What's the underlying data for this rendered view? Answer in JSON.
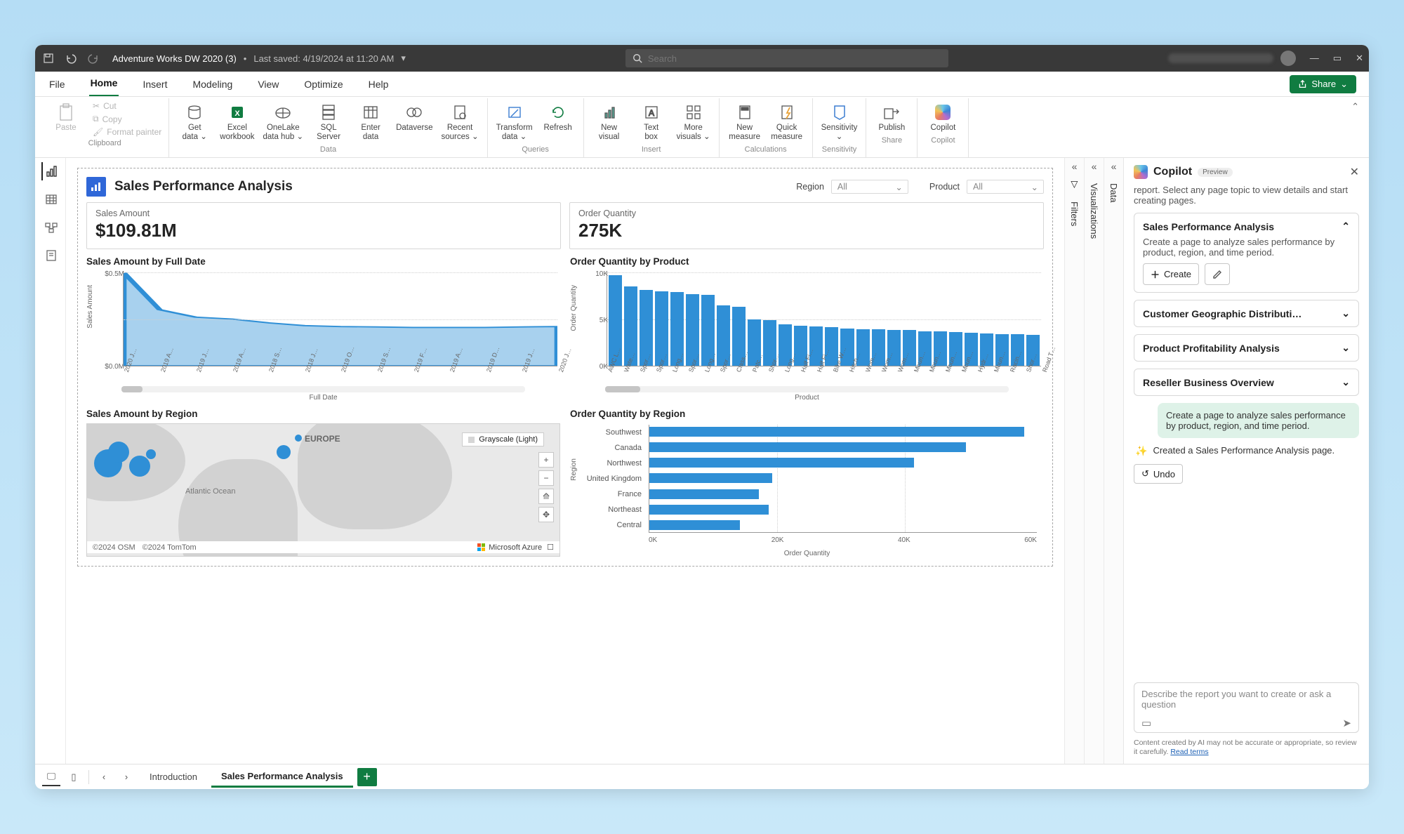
{
  "titlebar": {
    "file_name": "Adventure Works DW 2020 (3)",
    "saved": "Last saved: 4/19/2024 at 11:20 AM",
    "search_placeholder": "Search"
  },
  "menus": {
    "file": "File",
    "home": "Home",
    "insert": "Insert",
    "modeling": "Modeling",
    "view": "View",
    "optimize": "Optimize",
    "help": "Help",
    "share": "Share"
  },
  "ribbon": {
    "clipboard": {
      "paste": "Paste",
      "cut": "Cut",
      "copy": "Copy",
      "fmt": "Format painter",
      "label": "Clipboard"
    },
    "data": {
      "get": "Get\ndata",
      "excel": "Excel\nworkbook",
      "onelake": "OneLake\ndata hub",
      "sql": "SQL\nServer",
      "enter": "Enter\ndata",
      "dataverse": "Dataverse",
      "recent": "Recent\nsources",
      "label": "Data"
    },
    "queries": {
      "transform": "Transform\ndata",
      "refresh": "Refresh",
      "label": "Queries"
    },
    "insert": {
      "visual": "New\nvisual",
      "text": "Text\nbox",
      "more": "More\nvisuals",
      "label": "Insert"
    },
    "calc": {
      "measure": "New\nmeasure",
      "quick": "Quick\nmeasure",
      "label": "Calculations"
    },
    "sens": {
      "sens": "Sensitivity",
      "label": "Sensitivity"
    },
    "share": {
      "pub": "Publish",
      "label": "Share"
    },
    "copilot": {
      "cop": "Copilot",
      "label": "Copilot"
    }
  },
  "report": {
    "title": "Sales Performance Analysis",
    "filter_region_label": "Region",
    "filter_region_value": "All",
    "filter_product_label": "Product",
    "filter_product_value": "All",
    "card1_label": "Sales Amount",
    "card1_value": "$109.81M",
    "card2_label": "Order Quantity",
    "card2_value": "275K",
    "c1_title": "Sales Amount by Full Date",
    "c1_xlabel": "Full Date",
    "c1_ylabel": "Sales Amount",
    "c2_title": "Order Quantity by Product",
    "c2_xlabel": "Product",
    "c2_ylabel": "Order Quantity",
    "c3_title": "Sales Amount by Region",
    "c4_title": "Order Quantity by Region",
    "c4_xlabel": "Order Quantity",
    "c4_ylabel": "Region",
    "map_style": "Grayscale (Light)",
    "map_attrib1": "©2024 OSM",
    "map_attrib2": "©2024 TomTom",
    "map_azure": "Microsoft Azure",
    "map_ocean": "Atlantic Ocean",
    "map_europe": "EUROPE"
  },
  "chart_data": [
    {
      "id": "sales_by_date",
      "type": "area",
      "xlabel": "Full Date",
      "ylabel": "Sales Amount",
      "ylim": [
        0,
        500000
      ],
      "yticks": [
        "$0.5M",
        "$0.0M"
      ],
      "categories": [
        "2020 J…",
        "2019 A…",
        "2019 J…",
        "2019 A…",
        "2018 S…",
        "2018 J…",
        "2019 O…",
        "2019 S…",
        "2019 F…",
        "2019 A…",
        "2019 D…",
        "2019 J…",
        "2020 J…"
      ],
      "values": [
        500000,
        300000,
        260000,
        250000,
        230000,
        215000,
        210000,
        208000,
        205000,
        205000,
        205000,
        208000,
        210000
      ]
    },
    {
      "id": "qty_by_product",
      "type": "bar",
      "xlabel": "Product",
      "ylabel": "Order Quantity",
      "ylim": [
        0,
        10000
      ],
      "yticks": [
        "10K",
        "5K",
        "0K"
      ],
      "categories": [
        "AWC L…",
        "Wate…",
        "Spor…",
        "Spor…",
        "Long…",
        "Spor…",
        "Long…",
        "Spor…",
        "Class…",
        "Patc…",
        "Shor…",
        "Long…",
        "Half Fi…",
        "Half Fi…",
        "Bike W…",
        "Hitch…",
        "Wom…",
        "Wom…",
        "Wom…",
        "Moun…",
        "Moun…",
        "Moun…",
        "Moun…",
        "Hydr…",
        "Moun…",
        "Racin…",
        "Shor…",
        "Road T…"
      ],
      "values": [
        9700,
        8500,
        8100,
        8000,
        7900,
        7700,
        7600,
        6500,
        6300,
        5000,
        4900,
        4400,
        4300,
        4200,
        4100,
        4000,
        3900,
        3900,
        3850,
        3800,
        3700,
        3650,
        3600,
        3500,
        3450,
        3400,
        3350,
        3300
      ]
    },
    {
      "id": "qty_by_region",
      "type": "hbar",
      "xlabel": "Order Quantity",
      "ylabel": "Region",
      "xlim": [
        0,
        60000
      ],
      "xticks": [
        "0K",
        "20K",
        "40K",
        "60K"
      ],
      "categories": [
        "Southwest",
        "Canada",
        "Northwest",
        "United Kingdom",
        "France",
        "Northeast",
        "Central"
      ],
      "values": [
        58000,
        49000,
        41000,
        19000,
        17000,
        18500,
        14000
      ]
    }
  ],
  "rails": {
    "filters": "Filters",
    "viz": "Visualizations",
    "data": "Data"
  },
  "copilot": {
    "title": "Copilot",
    "preview": "Preview",
    "intro": "report. Select any page topic to view details and start creating pages.",
    "s1_title": "Sales Performance Analysis",
    "s1_desc": "Create a page to analyze sales performance by product, region, and time period.",
    "create": "Create",
    "s2": "Customer Geographic Distributi…",
    "s3": "Product Profitability Analysis",
    "s4": "Reseller Business Overview",
    "user_msg": "Create a page to analyze sales performance by product, region, and time period.",
    "resp": "Created a Sales Performance Analysis page.",
    "undo": "Undo",
    "placeholder": "Describe the report you want to create or ask a question",
    "disclaimer": "Content created by AI may not be accurate or appropriate, so review it carefully.",
    "terms": "Read terms"
  },
  "tabs": {
    "p1": "Introduction",
    "p2": "Sales Performance Analysis"
  }
}
